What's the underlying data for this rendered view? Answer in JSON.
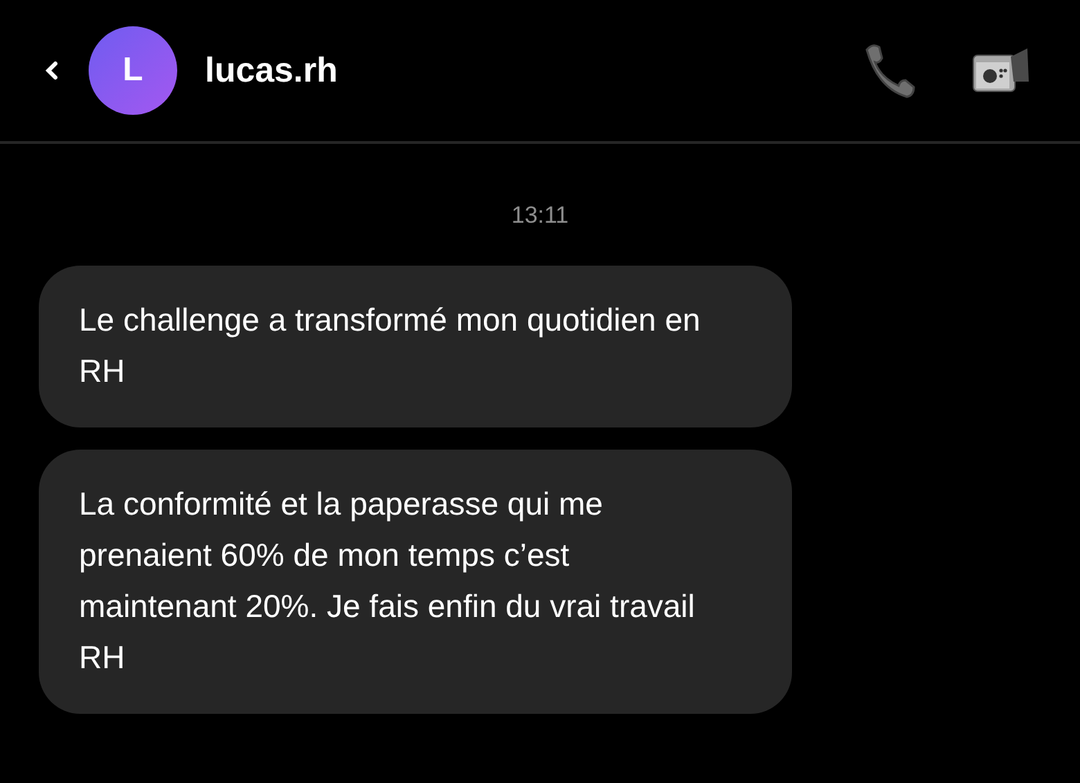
{
  "header": {
    "avatar_letter": "L",
    "name": "lucas.rh"
  },
  "conversation": {
    "timestamp": "13:11",
    "messages": [
      {
        "text": "Le challenge a transformé mon quotidien en RH"
      },
      {
        "text": "La conformité et la paperasse qui me prenaient 60% de mon temps c’est maintenant 20%. Je fais enfin du vrai travail RH"
      }
    ]
  }
}
